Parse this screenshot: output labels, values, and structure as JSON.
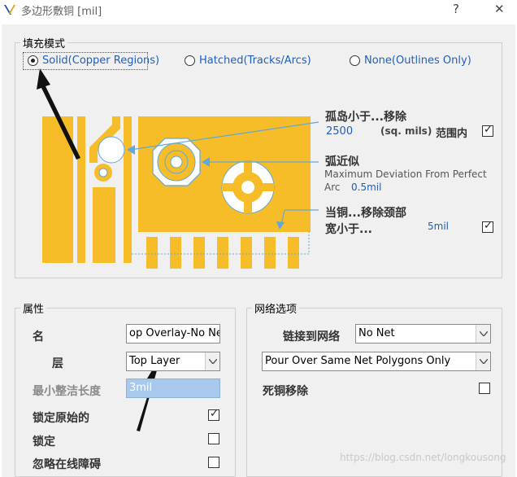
{
  "window": {
    "title": "多边形敷铜 [mil]",
    "help_glyph": "?",
    "close_glyph": "✕"
  },
  "fill_mode": {
    "title": "填充模式",
    "options": [
      {
        "label": "Solid(Copper Regions)",
        "selected": true
      },
      {
        "label": "Hatched(Tracks/Arcs)",
        "selected": false
      },
      {
        "label": "None(Outlines Only)",
        "selected": false
      }
    ]
  },
  "island": {
    "label": "孤岛小于...移除",
    "value": "2500",
    "unit": "(sq. mils)",
    "suffix": "范围内",
    "checked": true
  },
  "arc_approx": {
    "label": "弧近似",
    "desc_line1": "Maximum Deviation From Perfect",
    "desc_line2": "Arc",
    "value": "0.5mil"
  },
  "neck": {
    "label_line1": "当铜...移除颈部",
    "label_line2": "宽小于...",
    "value": "5mil",
    "checked": true
  },
  "properties": {
    "title": "属性",
    "name_label": "名",
    "name_value": "op Overlay-No Net",
    "layer_label": "层",
    "layer_value": "Top Layer",
    "min_len_label": "最小整洁长度",
    "min_len_value": "3mil",
    "lock_primitives_label": "锁定原始的",
    "lock_primitives_checked": true,
    "locked_label": "锁定",
    "locked_checked": false,
    "ignore_obstacles_label": "忽略在线障碍",
    "ignore_obstacles_checked": false
  },
  "net_options": {
    "title": "网络选项",
    "connect_label": "链接到网络",
    "connect_value": "No Net",
    "pour_value": "Pour Over Same Net Polygons Only",
    "remove_dead_label": "死铜移除",
    "remove_dead_checked": false
  },
  "watermark": "https://blog.csdn.net/longkousong",
  "colors": {
    "copper": "#f7bd28",
    "outline": "#60a8d8",
    "accent": "#1a5fc0"
  }
}
